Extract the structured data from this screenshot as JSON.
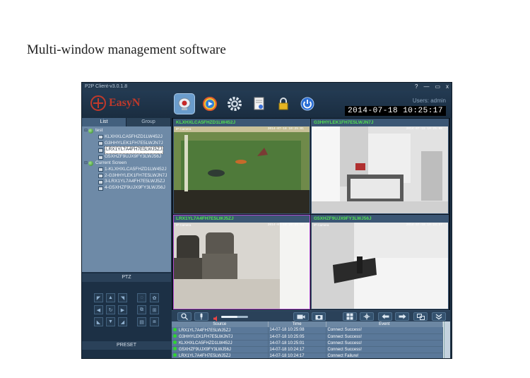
{
  "caption": "Multi-window management software",
  "window": {
    "title": "P2P Client-v3.0.1.8",
    "controls": [
      "?",
      "—",
      "▭",
      "x"
    ]
  },
  "toolbar": {
    "logo_text": "EasyN",
    "users_label": "Users: admin",
    "clock": "2014-07-18 10:25:17",
    "buttons": [
      "live-view",
      "playback",
      "settings",
      "log",
      "lock",
      "power"
    ]
  },
  "left_panel": {
    "tabs": [
      "List",
      "Group"
    ],
    "tree": [
      {
        "label": "test",
        "level": 0,
        "kind": "group"
      },
      {
        "label": "KLXHXLCA5FHZD1LW452J",
        "level": 1,
        "kind": "camera"
      },
      {
        "label": "G3HHYLEK1FH7E5LWJN7J",
        "level": 1,
        "kind": "camera"
      },
      {
        "label": "LRX1YL7A4FH7E5LWJ5ZJ",
        "level": 1,
        "kind": "camera",
        "selected": true
      },
      {
        "label": "G5XHZF9UJX9FY3LWJ56J",
        "level": 1,
        "kind": "camera"
      },
      {
        "label": "Current Screen",
        "level": 0,
        "kind": "group"
      },
      {
        "label": "1-KLXHXLCA5FHZD1LW452J",
        "level": 1,
        "kind": "camera"
      },
      {
        "label": "2-G3HHYLEK1FH7E5LWJN7J",
        "level": 1,
        "kind": "camera"
      },
      {
        "label": "3-LRX1YL7A4FH7E5LWJ5ZJ",
        "level": 1,
        "kind": "camera"
      },
      {
        "label": "4-G5XHZF9UJX9FY3LWJ56J",
        "level": 1,
        "kind": "camera"
      }
    ],
    "ptz_label": "PTZ",
    "preset_label": "PRESET"
  },
  "viewports": [
    {
      "title": "KLXHXLCA5FHZD1LW452J",
      "cam": "IP Camera",
      "timestamp": "2014-07-18 10:25:01"
    },
    {
      "title": "G3HHYLEK1FH7E5LWJN7J",
      "cam": "IP Camera",
      "timestamp": "2014-07-18 10:25:08"
    },
    {
      "title": "LRX1YL7A4FH7E5LWJ5ZJ",
      "cam": "IP Camera",
      "timestamp": "2014-07-18 10:25:04"
    },
    {
      "title": "G5XHZF9UJX9FY3LWJ56J",
      "cam": "IP Camera",
      "timestamp": "2014-07-18 10:24:57"
    }
  ],
  "volume_level": 0.6,
  "log": {
    "headers": [
      "Source",
      "Time",
      "Event"
    ],
    "rows": [
      {
        "source": "LRX1YL7A4FH7E5LWJ5ZJ",
        "time": "14-07-18 10:25:08",
        "event": "Connect Success!"
      },
      {
        "source": "G3HHYLEK1FH7E5LWJN7J",
        "time": "14-07-18 10:25:05",
        "event": "Connect Success!"
      },
      {
        "source": "KLXHXLCA5FHZD1LW452J",
        "time": "14-07-18 10:25:01",
        "event": "Connect Success!"
      },
      {
        "source": "G5XHZF9UJX9FY3LWJ56J",
        "time": "14-07-18 10:24:17",
        "event": "Connect Success!"
      },
      {
        "source": "LRX1YL7A4FH7E5LWJ5ZJ",
        "time": "14-07-18 10:24:17",
        "event": "Connect Failure!"
      }
    ]
  }
}
